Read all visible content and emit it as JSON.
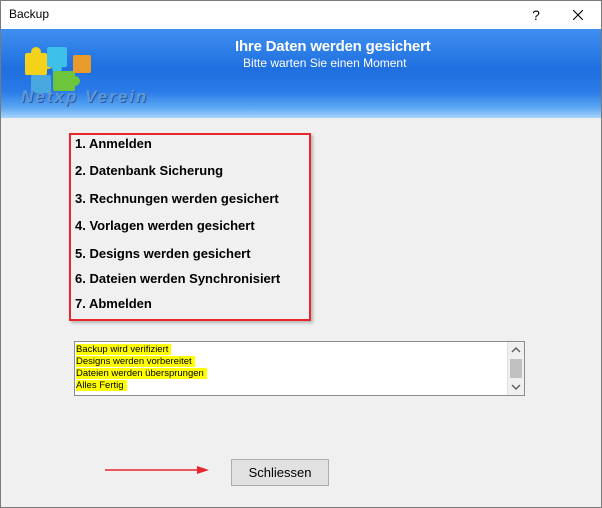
{
  "window": {
    "title": "Backup",
    "help_label": "?"
  },
  "banner": {
    "heading": "Ihre Daten werden gesichert",
    "subheading": "Bitte warten Sie einen Moment",
    "logo_text": "Netxp Verein"
  },
  "steps": [
    "1. Anmelden",
    "2. Datenbank Sicherung",
    "3. Rechnungen werden gesichert",
    "4. Vorlagen werden gesichert",
    "5. Designs werden gesichert",
    "6. Dateien werden Synchronisiert",
    "7. Abmelden"
  ],
  "log": [
    "Backup wird verifiziert",
    "Designs werden vorbereitet",
    "Dateien werden übersprungen",
    "Alles Fertig"
  ],
  "buttons": {
    "close_label": "Schliessen"
  },
  "colors": {
    "highlight": "#ff0000",
    "log_highlight": "#ffff00",
    "banner_blue": "#1f6fe0"
  }
}
